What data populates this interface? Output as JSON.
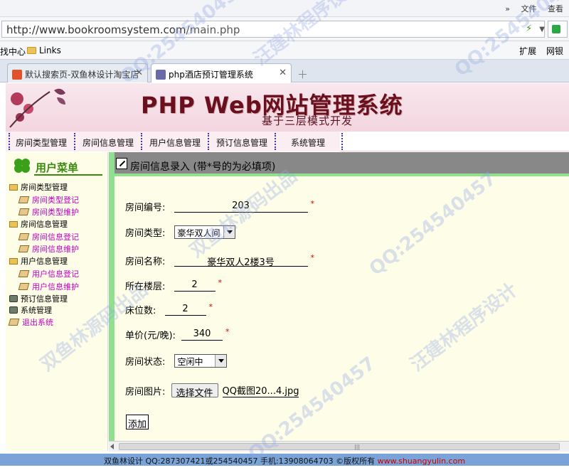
{
  "browser": {
    "top_tools": [
      "»",
      "文件",
      "查看"
    ],
    "url_host": "http://www.bookroomsystem.com",
    "url_path": "/main.php",
    "bookmarks": [
      "找中心",
      "Links"
    ],
    "bookmarks_right": [
      "扩展",
      "网银"
    ],
    "tabs": [
      {
        "label": "默认搜索页-双鱼林设计淘宝店",
        "active": false
      },
      {
        "label": "php酒店预订管理系统",
        "active": true
      }
    ]
  },
  "banner": {
    "title": "PHP Web网站管理系统",
    "subtitle": "基于三层模式开发"
  },
  "nav": {
    "items": [
      "房间类型管理",
      "房间信息管理",
      "用户信息管理",
      "预订信息管理",
      "系统管理"
    ]
  },
  "sidebar": {
    "heading": "用户菜单",
    "tree": [
      {
        "label": "房间类型管理",
        "level": 0
      },
      {
        "label": "房间类型登记",
        "level": 1
      },
      {
        "label": "房间类型维护",
        "level": 1
      },
      {
        "label": "房间信息管理",
        "level": 0
      },
      {
        "label": "房间信息登记",
        "level": 1
      },
      {
        "label": "房间信息维护",
        "level": 1
      },
      {
        "label": "用户信息管理",
        "level": 0
      },
      {
        "label": "用户信息登记",
        "level": 1
      },
      {
        "label": "用户信息维护",
        "level": 1
      },
      {
        "label": "预订信息管理",
        "level": 0
      },
      {
        "label": "系统管理",
        "level": 0
      },
      {
        "label": "退出系统",
        "level": 0
      }
    ]
  },
  "form": {
    "heading": "房间信息录入 (带*号的为必填项)",
    "fields": {
      "room_no": {
        "label": "房间编号:",
        "value": "203"
      },
      "room_type": {
        "label": "房间类型:",
        "value": "豪华双人间"
      },
      "room_name": {
        "label": "房间名称:",
        "value": "豪华双人2楼3号"
      },
      "floor": {
        "label": "所在楼层:",
        "value": "2"
      },
      "beds": {
        "label": "床位数:",
        "value": "2"
      },
      "price": {
        "label": "单价(元/晚):",
        "value": "340"
      },
      "status": {
        "label": "房间状态:",
        "value": "空闲中"
      },
      "photo": {
        "label": "房间图片:",
        "button": "选择文件",
        "filename": "QQ截图20...4.jpg"
      }
    },
    "required_mark": "*",
    "submit_label": "添加"
  },
  "footer": {
    "text": "双鱼林设计 QQ:287307421或254540457 手机:13908064703 ©版权所有",
    "link": "www.shuangyulin.com"
  },
  "watermarks": [
    "QQ:254540457",
    "汪建林程序设计",
    "双鱼林源码出品"
  ],
  "colors": {
    "accent_green": "#90e090",
    "header_bar": "#888888",
    "footer_bg": "#7aa4d8",
    "link_magenta": "#c000c0",
    "required_red": "#dd0000",
    "title_maroon": "#6b0f1e"
  }
}
